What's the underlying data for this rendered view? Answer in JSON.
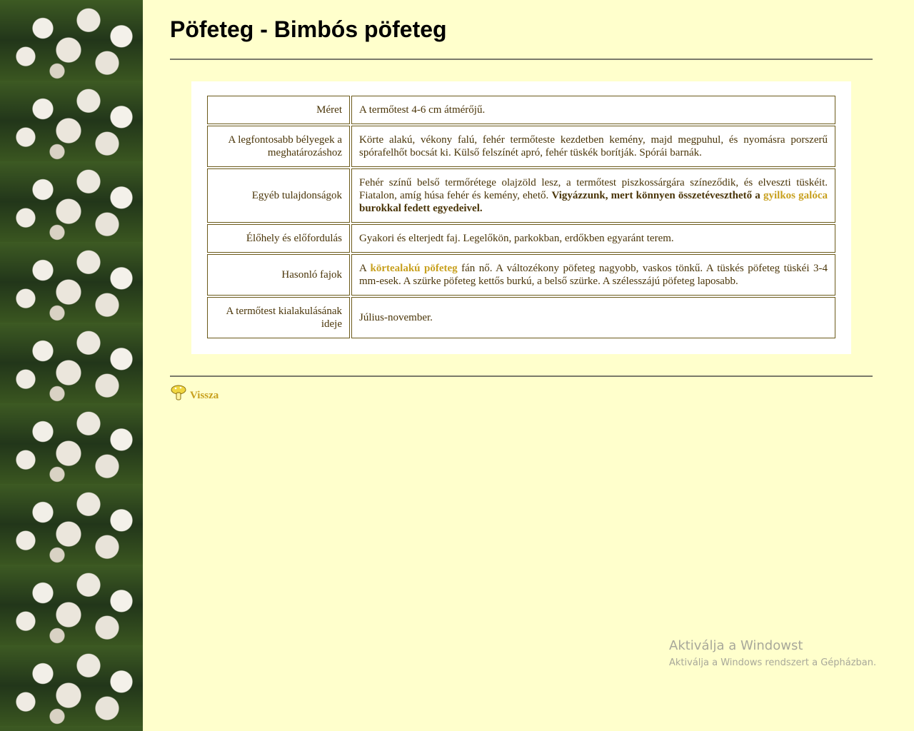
{
  "page": {
    "title": "Pöfeteg - Bimbós pöfeteg"
  },
  "rows": [
    {
      "label": "Méret",
      "value": "A termőtest 4-6 cm átmérőjű."
    },
    {
      "label": "A legfontosabb bélyegek a meghatározáshoz",
      "value": "Körte alakú, vékony falú, fehér termőteste kezdetben kemény, majd megpuhul, és nyomásra porszerű spórafelhőt bocsát ki. Külső felszínét apró, fehér tüskék borítják. Spórái barnák."
    },
    {
      "label": "Egyéb tulajdonságok",
      "value_a": "Fehér színű belső termőrétege olajzöld lesz, a termőtest piszkossárgára színeződik, és elveszti tüskéit. Fiatalon, amíg húsa fehér és kemény, ehető. ",
      "value_bold_a": "Vigyázzunk, mert könnyen összetéveszthető a ",
      "link": "gyilkos galóca",
      "value_bold_b": " burokkal fedett egyedeivel."
    },
    {
      "label": "Élőhely és előfordulás",
      "value": "Gyakori és elterjedt faj. Legelőkön, parkokban, erdőkben egyaránt terem."
    },
    {
      "label": "Hasonló fajok",
      "value_a": "A ",
      "link": "körtealakú pöfeteg",
      "value_b": " fán nő. A változékony pöfeteg nagyobb, vaskos tönkű. A tüskés pöfeteg tüskéi 3-4 mm-esek. A szürke pöfeteg kettős burkú, a belső szürke. A szélesszájú pöfeteg laposabb."
    },
    {
      "label": "A termőtest kialakulásának ideje",
      "value": "Július-november."
    }
  ],
  "back": {
    "label": "Vissza",
    "icon": "mushroom-icon"
  },
  "watermark": {
    "title": "Aktiválja a Windowst",
    "subtitle": "Aktiválja a Windows rendszert a Gépházban."
  },
  "colors": {
    "background": "#ffffcc",
    "link": "#c8a01e",
    "text": "#4a3508"
  }
}
